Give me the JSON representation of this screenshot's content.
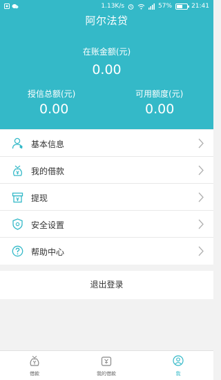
{
  "status_bar": {
    "network_speed": "1.13K/s",
    "battery_level": "57%",
    "battery_fraction": 0.57,
    "time": "21:41"
  },
  "header": {
    "title": "阿尔法贷",
    "in_account_label": "在账金额(元)",
    "in_account_value": "0.00",
    "credit_total_label": "授信总额(元)",
    "credit_total_value": "0.00",
    "available_label": "可用额度(元)",
    "available_value": "0.00"
  },
  "menu": {
    "items": [
      {
        "label": "基本信息",
        "icon": "user-icon"
      },
      {
        "label": "我的借款",
        "icon": "money-bag-icon"
      },
      {
        "label": "提现",
        "icon": "withdraw-icon"
      },
      {
        "label": "安全设置",
        "icon": "shield-icon"
      },
      {
        "label": "帮助中心",
        "icon": "help-icon"
      }
    ]
  },
  "logout_label": "退出登录",
  "tabbar": {
    "tabs": [
      {
        "label": "借款",
        "icon": "loan-bag-icon"
      },
      {
        "label": "我的借款",
        "icon": "my-loans-icon"
      },
      {
        "label": "我",
        "icon": "me-icon",
        "active": true
      }
    ]
  },
  "colors": {
    "accent": "#34b9c8",
    "background": "#f2f2f2",
    "text": "#333333"
  }
}
